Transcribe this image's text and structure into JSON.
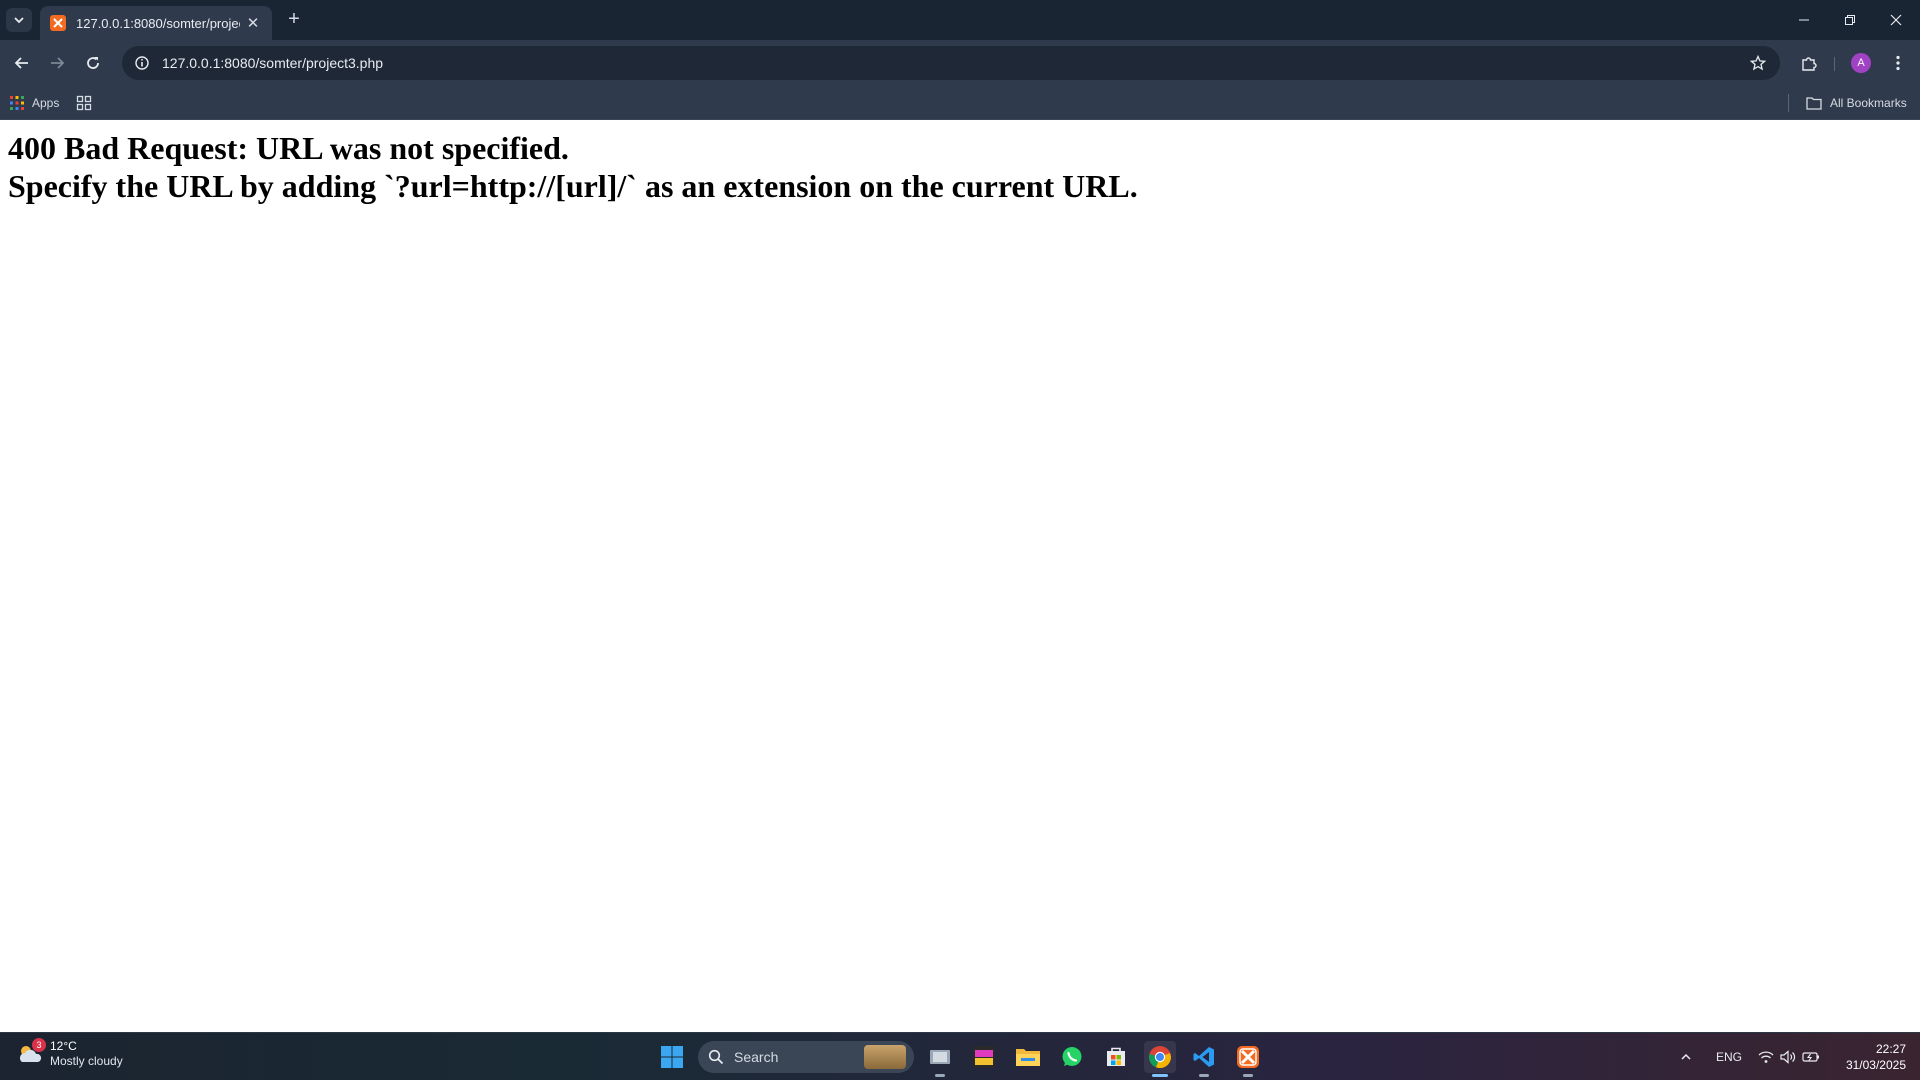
{
  "browser": {
    "tab": {
      "title": "127.0.0.1:8080/somter/project3.php"
    },
    "address_bar": {
      "url": "127.0.0.1:8080/somter/project3.php"
    },
    "avatar_letter": "A",
    "bookmarks": {
      "apps_label": "Apps",
      "all_bookmarks_label": "All Bookmarks"
    },
    "colors": {
      "tab_strip": "#1a2533",
      "toolbar": "#2f3b4c",
      "favicon": "#f26b21",
      "avatar": "#a142c4"
    }
  },
  "page": {
    "line1": "400 Bad Request: URL was not specified.",
    "line2": "Specify the URL by adding `?url=http://[url]/` as an extension on the current URL."
  },
  "taskbar": {
    "weather": {
      "temp": "12°C",
      "desc": "Mostly cloudy",
      "badge": "3"
    },
    "search_label": "Search",
    "apps": [
      "task-view",
      "game-app",
      "file-explorer",
      "whatsapp",
      "microsoft-store",
      "chrome",
      "vscode",
      "xampp"
    ],
    "tray": {
      "language": "ENG"
    },
    "clock": {
      "time": "22:27",
      "date": "31/03/2025"
    }
  }
}
